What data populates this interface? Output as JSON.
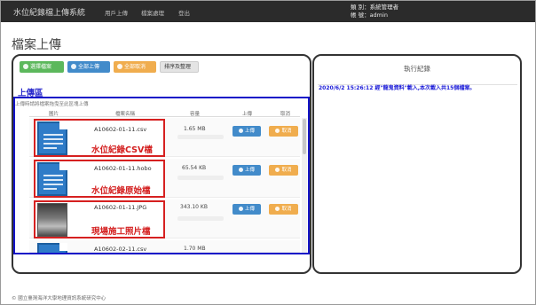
{
  "app": {
    "brand": "水位紀錄檔上傳系統",
    "nav": [
      "用戶上傳",
      "檔案處理",
      "登出"
    ],
    "user_role_line": "類 別：系統管理者",
    "user_account_line": "帳 號：admin"
  },
  "page_title": "檔案上傳",
  "toolbar": {
    "select_files": "選擇檔案",
    "upload_all": "全部上傳",
    "cancel_all": "全部取消",
    "sort_arrange": "排序及整理"
  },
  "upload_area": {
    "title": "上傳區",
    "hint": "上傳時請將檔案拖曳至此區塊上傳",
    "columns": [
      "圖片",
      "檔案名稱",
      "容量",
      "上傳",
      "取消"
    ],
    "upload_label": "上傳",
    "cancel_label": "取消",
    "rows": [
      {
        "filename": "A10602-01-11.csv",
        "size": "1.65 MB",
        "label": "水位紀錄CSV檔",
        "icon": "document-icon"
      },
      {
        "filename": "A10602-01-11.hobo",
        "size": "65.54 KB",
        "label": "水位紀錄原始檔",
        "icon": "document-icon"
      },
      {
        "filename": "A10602-01-11.JPG",
        "size": "343.10 KB",
        "label": "現場施工照片檔",
        "icon": "photo-thumbnail"
      },
      {
        "filename": "A10602-02-11.csv",
        "size": "1.70 MB",
        "label": "",
        "icon": "document-icon"
      }
    ]
  },
  "log_panel": {
    "title": "執行紀錄",
    "entry": "2020/6/2 15:26:12 經\"龍鬼資料\"載入,本次載入共15個檔案。"
  },
  "footer": "© 國立臺灣海洋大學地理資訊系統研究中心",
  "colors": {
    "navbar": "#2b2b2b",
    "green_button": "#5cb85c",
    "blue_button": "#428bca",
    "orange_button": "#f0ad4e",
    "highlight_blue": "#1414c8",
    "highlight_red": "#d62020"
  }
}
